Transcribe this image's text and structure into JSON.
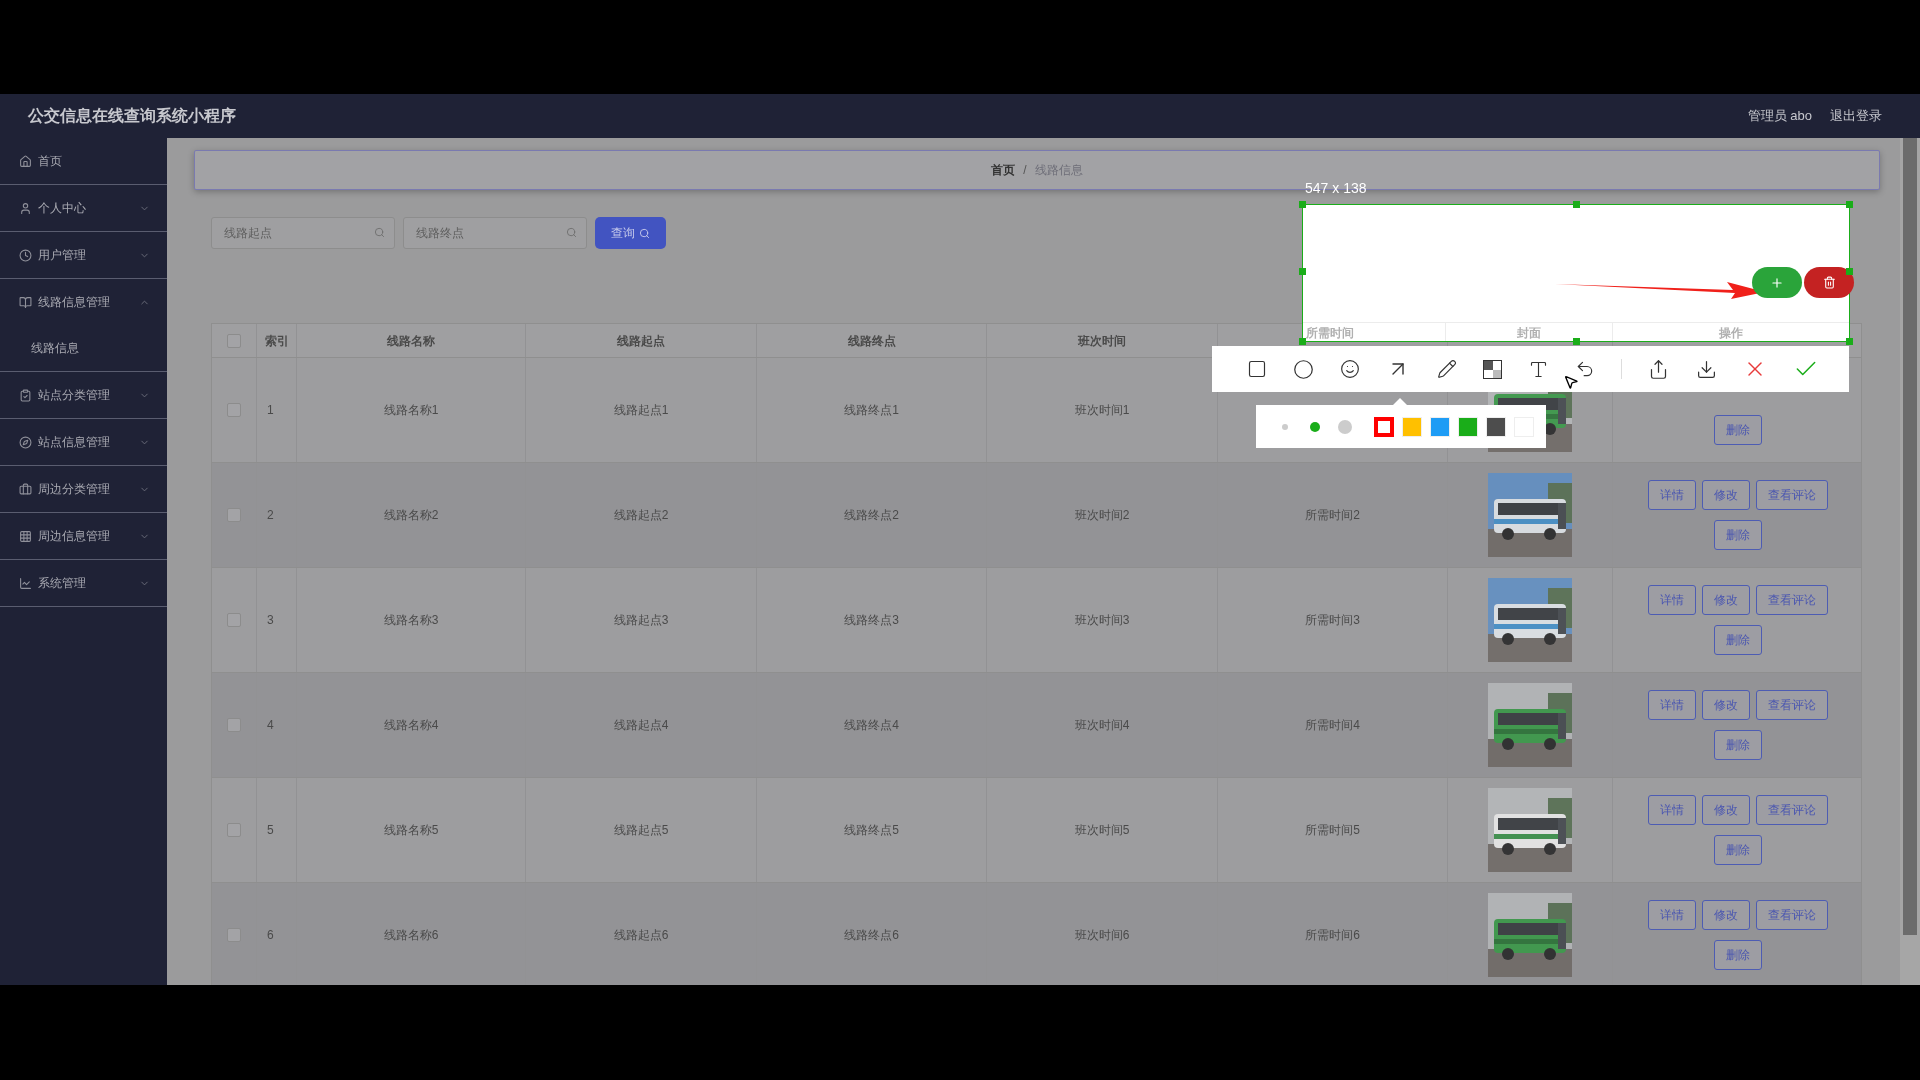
{
  "header": {
    "title": "公交信息在线查询系统小程序",
    "user": "管理员 abo",
    "logout": "退出登录"
  },
  "sidebar": {
    "items": [
      {
        "label": "首页",
        "kind": "link"
      },
      {
        "label": "个人中心",
        "kind": "group",
        "expanded": false
      },
      {
        "label": "用户管理",
        "kind": "group",
        "expanded": false
      },
      {
        "label": "线路信息管理",
        "kind": "group",
        "expanded": true,
        "children": [
          {
            "label": "线路信息"
          }
        ]
      },
      {
        "label": "站点分类管理",
        "kind": "group",
        "expanded": false
      },
      {
        "label": "站点信息管理",
        "kind": "group",
        "expanded": false
      },
      {
        "label": "周边分类管理",
        "kind": "group",
        "expanded": false
      },
      {
        "label": "周边信息管理",
        "kind": "group",
        "expanded": false
      },
      {
        "label": "系统管理",
        "kind": "group",
        "expanded": false
      }
    ]
  },
  "breadcrumb": {
    "items": [
      "首页",
      "线路信息"
    ],
    "separator": "/"
  },
  "search": {
    "fields": [
      {
        "placeholder": "线路起点"
      },
      {
        "placeholder": "线路终点"
      }
    ],
    "button": "查询"
  },
  "table": {
    "select_all": {
      "checked": false
    },
    "columns": [
      "索引",
      "线路名称",
      "线路起点",
      "线路终点",
      "班次时间"
    ],
    "rows": [
      {
        "checked": false,
        "cells": [
          "1",
          "线路名称1",
          "线路起点1",
          "线路终点1",
          "班次时间1"
        ],
        "cover": {
          "kind": "picture"
        },
        "actions_bottom": [
          "删除"
        ]
      },
      {
        "checked": false,
        "cells": [
          "2",
          "线路名称2",
          "线路起点2",
          "线路终点2",
          "班次时间2"
        ],
        "time": "所需时间2",
        "cover": {
          "kind": "picture"
        },
        "actions_top": [
          "详情",
          "修改",
          "查看评论"
        ],
        "actions_bottom": [
          "删除"
        ]
      },
      {
        "checked": false,
        "cells": [
          "3",
          "线路名称3",
          "线路起点3",
          "线路终点3",
          "班次时间3"
        ],
        "time": "所需时间3",
        "cover": {
          "kind": "picture"
        },
        "actions_top": [
          "详情",
          "修改",
          "查看评论"
        ],
        "actions_bottom": [
          "删除"
        ]
      },
      {
        "checked": false,
        "cells": [
          "4",
          "线路名称4",
          "线路起点4",
          "线路终点4",
          "班次时间4"
        ],
        "time": "所需时间4",
        "cover": {
          "kind": "picture"
        },
        "actions_top": [
          "详情",
          "修改",
          "查看评论"
        ],
        "actions_bottom": [
          "删除"
        ]
      },
      {
        "checked": false,
        "cells": [
          "5",
          "线路名称5",
          "线路起点5",
          "线路终点5",
          "班次时间5"
        ],
        "time": "所需时间5",
        "cover": {
          "kind": "picture"
        },
        "actions_top": [
          "详情",
          "修改",
          "查看评论"
        ],
        "actions_bottom": [
          "删除"
        ]
      },
      {
        "checked": false,
        "cells": [
          "6",
          "线路名称6",
          "线路起点6",
          "线路终点6",
          "班次时间6"
        ],
        "time": "所需时间6",
        "cover": {
          "kind": "picture"
        },
        "actions_top": [
          "详情",
          "修改",
          "查看评论"
        ],
        "actions_bottom": [
          "删除"
        ]
      }
    ]
  },
  "capture": {
    "size": "547 x 138",
    "header_cells": [
      "所需时间",
      "封面",
      "操作"
    ],
    "tools": [
      {
        "kind": "rectangle"
      },
      {
        "kind": "ellipse"
      },
      {
        "kind": "emoji"
      },
      {
        "kind": "arrow"
      },
      {
        "kind": "pen"
      },
      {
        "kind": "mosaic"
      },
      {
        "kind": "text"
      },
      {
        "kind": "undo"
      },
      {
        "kind": "separator"
      },
      {
        "kind": "share"
      },
      {
        "kind": "download"
      },
      {
        "kind": "cancel"
      },
      {
        "kind": "confirm"
      }
    ],
    "pen_sizes": [
      {
        "selected": false
      },
      {
        "selected": true
      },
      {
        "selected": false
      }
    ],
    "colors": [
      {
        "color": "#ff0000",
        "selected": true
      },
      {
        "color": "#ffc000",
        "selected": false
      },
      {
        "color": "#1e9cf5",
        "selected": false
      },
      {
        "color": "#1aad19",
        "selected": false
      },
      {
        "color": "#4d4d4d",
        "selected": false
      },
      {
        "color": "#ffffff",
        "selected": false
      }
    ]
  }
}
